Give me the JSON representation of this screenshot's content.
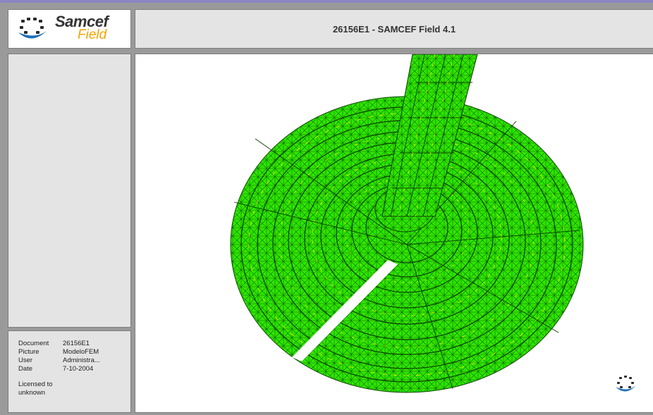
{
  "app": {
    "title": "26156E1 - SAMCEF Field 4.1",
    "logo_word_1": "Samcef",
    "logo_word_2": "Field"
  },
  "info": {
    "rows": [
      {
        "label": "Document",
        "value": "26156E1"
      },
      {
        "label": "Picture",
        "value": "ModeloFEM"
      },
      {
        "label": "User",
        "value": "Administra..."
      },
      {
        "label": "Date",
        "value": "7-10-2004"
      }
    ],
    "license_line_1": "Licensed to",
    "license_line_2": "unknown"
  },
  "colors": {
    "mesh_green": "#22e000",
    "mesh_yellow": "#f0f000",
    "mesh_line": "#114400",
    "logo_blue": "#1e6fb8",
    "logo_orange": "#f5a300"
  },
  "icons": {
    "logo": "samcef-logo-icon",
    "corner": "samcef-corner-logo-icon"
  }
}
